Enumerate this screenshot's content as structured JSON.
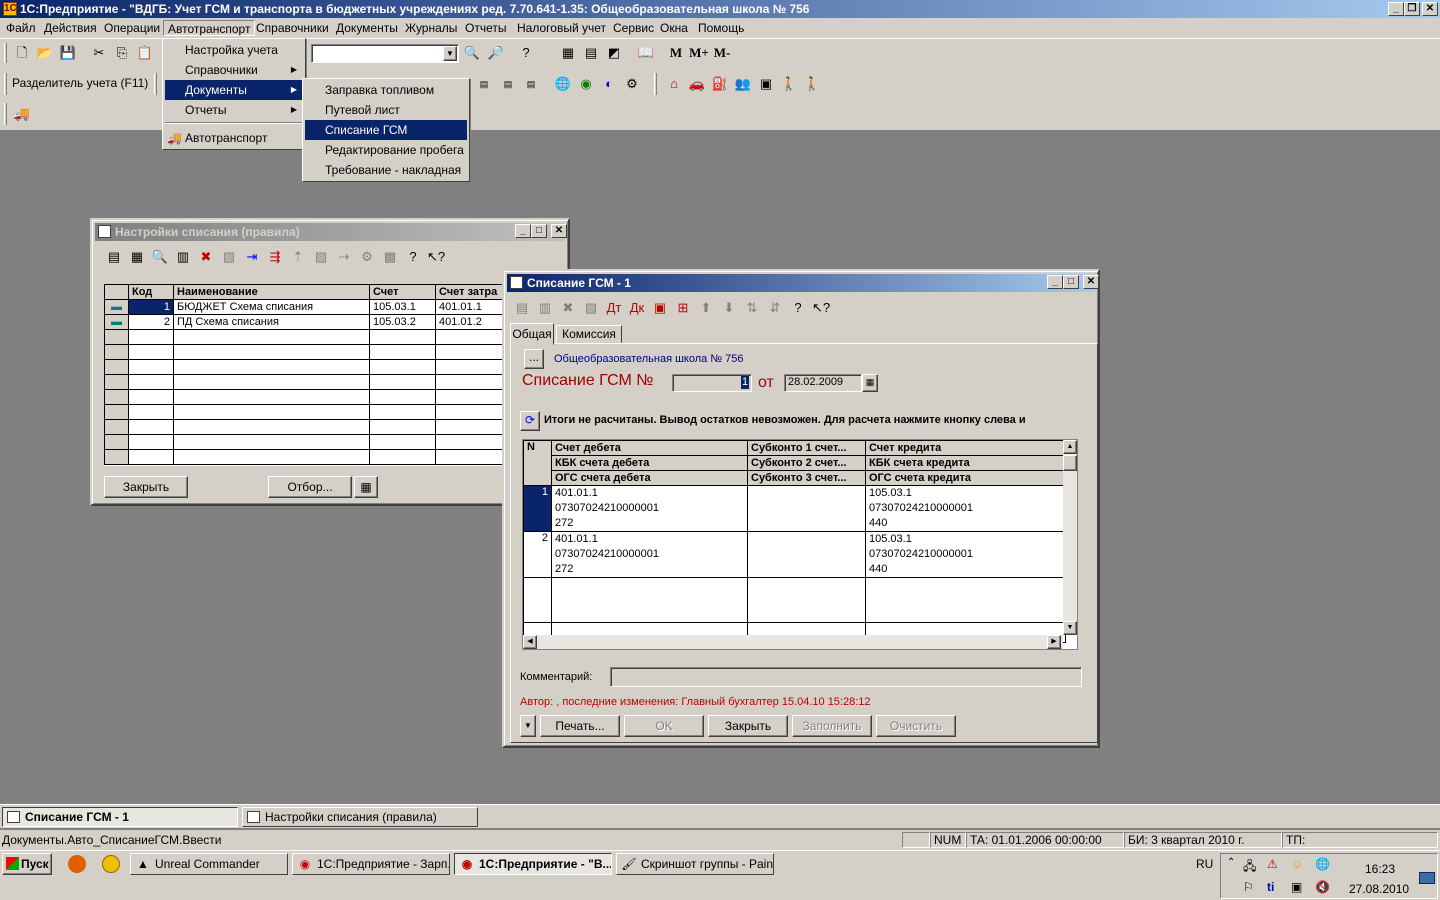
{
  "app": {
    "title": "1С:Предприятие - \"ВДГБ: Учет ГСМ и транспорта в бюджетных учреждениях ред. 7.70.641-1.35: Общеобразовательная школа № 756"
  },
  "menubar": [
    "Файл",
    "Действия",
    "Операции",
    "Автотранспорт",
    "Справочники",
    "Документы",
    "Журналы",
    "Отчеты",
    "Налоговый учет",
    "Сервис",
    "Окна",
    "Помощь"
  ],
  "toolbar2": {
    "separator_label": "Разделитель учета (F11)"
  },
  "toolbar1": {
    "mplus": "M+",
    "mminus": "M-",
    "m": "M"
  },
  "menu_autotransport": {
    "items": [
      "Настройка учета",
      "Справочники",
      "Документы",
      "Отчеты",
      "Автотранспорт"
    ]
  },
  "menu_documents": {
    "items": [
      "Заправка топливом",
      "Путевой лист",
      "Списание ГСМ",
      "Редактирование пробега",
      "Требование - накладная"
    ],
    "selected": "Списание ГСМ"
  },
  "settings_window": {
    "title": "Настройки списания (правила)",
    "columns": [
      "Код",
      "Наименование",
      "Счет",
      "Счет затра"
    ],
    "rows": [
      {
        "code": "1",
        "name": "БЮДЖЕТ Схема списания",
        "account": "105.03.1",
        "cost": "401.01.1"
      },
      {
        "code": "2",
        "name": "ПД Схема списания",
        "account": "105.03.2",
        "cost": "401.01.2"
      }
    ],
    "close_label": "Закрыть",
    "filter_label": "Отбор..."
  },
  "doc_window": {
    "title": "Списание ГСМ - 1",
    "tabs": [
      "Общая",
      "Комиссия"
    ],
    "org_button": "...",
    "org": "Общеобразовательная школа № 756",
    "doc_label": "Списание ГСМ №",
    "number": "1",
    "from_label": "от",
    "date": "28.02.2009",
    "warning": "Итоги не расчитаны. Вывод остатков невозможен. Для расчета нажмите кнопку слева и",
    "grid_headers": {
      "n": "N",
      "col1": [
        "Счет дебета",
        "КБК счета дебета",
        "ОГС счета дебета"
      ],
      "col2": [
        "Субконто 1 счет...",
        "Субконто 2 счет...",
        "Субконто 3 счет..."
      ],
      "col3": [
        "Счет кредита",
        "КБК счета кредита",
        "ОГС счета кредита"
      ]
    },
    "grid_rows": [
      {
        "n": "1",
        "debit": [
          "401.01.1",
          "07307024210000001",
          "272"
        ],
        "credit": [
          "105.03.1",
          "07307024210000001",
          "440"
        ]
      },
      {
        "n": "2",
        "debit": [
          "401.01.1",
          "07307024210000001",
          "272"
        ],
        "credit": [
          "105.03.1",
          "07307024210000001",
          "440"
        ]
      }
    ],
    "comment_label": "Комментарий:",
    "comment": "",
    "author": "Автор: , последние изменения: Главный бухгалтер 15.04.10 15:28:12",
    "buttons": {
      "print": "Печать...",
      "ok": "OK",
      "close": "Закрыть",
      "fill": "Заполнить",
      "clear": "Очистить"
    }
  },
  "window_tabs": [
    "Списание ГСМ - 1",
    "Настройки списания (правила)"
  ],
  "statusbar": {
    "path": "Документы.Авто_СписаниеГСМ.Ввести",
    "num": "NUM",
    "ta": "ТА: 01.01.2006  00:00:00",
    "bi": "БИ: 3 квартал 2010 г.",
    "tp": "ТП:"
  },
  "taskbar": {
    "start": "Пуск",
    "tasks": [
      "Unreal Commander",
      "1С:Предприятие - Зарп...",
      "1С:Предприятие - \"В...",
      "Скриншот группы - Paint"
    ],
    "lang": "RU",
    "time": "16:23",
    "date": "27.08.2010"
  },
  "colors": {
    "accent": "#0a246a",
    "doc_title_red": "#a00000",
    "warning_red": "#c00000"
  }
}
